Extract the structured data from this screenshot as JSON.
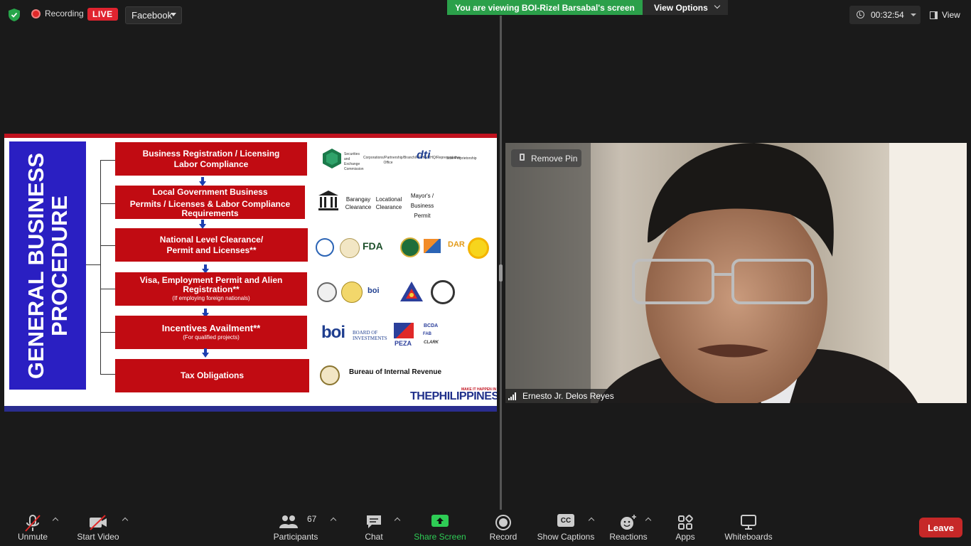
{
  "topbar": {
    "recording_label": "Recording",
    "live_label": "LIVE",
    "stream_target": "Facebook",
    "viewing_banner": "You are viewing BOI-Rizel Barsabal's screen",
    "view_options_label": "View Options",
    "elapsed_time": "00:32:54",
    "view_label": "View"
  },
  "slide": {
    "title_line1": "GENERAL BUSINESS",
    "title_line2": "PROCEDURE",
    "steps": [
      {
        "line1": "Business Registration / Licensing",
        "line2": "Labor Compliance",
        "sub": ""
      },
      {
        "line1": "Local Government Business",
        "line2": "Permits / Licenses & Labor Compliance Requirements",
        "sub": ""
      },
      {
        "line1": "National Level Clearance/",
        "line2": "Permit and Licenses**",
        "sub": ""
      },
      {
        "line1": "Visa, Employment Permit and Alien Registration**",
        "line2": "",
        "sub": "(If employing foreign nationals)"
      },
      {
        "line1": "Incentives Availment**",
        "line2": "",
        "sub": "(For qualified projects)"
      },
      {
        "line1": "Tax Obligations",
        "line2": "",
        "sub": ""
      }
    ],
    "row1": {
      "sec_name": "Securities and Exchange Commission",
      "sec_desc": "Corporations/Partnership/Branch/ROHQ/RHQ/Representative Office",
      "dti": "dti",
      "dti_desc": "Sole Proprietorship"
    },
    "row2": {
      "barangay": "Barangay Clearance",
      "locational": "Locational Clearance",
      "mayors": "Mayor's / Business Permit"
    },
    "row3": {
      "fda": "FDA",
      "dar": "DAR"
    },
    "row4": {
      "boi": "boi"
    },
    "row5": {
      "boi": "boi",
      "boi_name": "BOARD OF INVESTMENTS",
      "peza": "PEZA",
      "bcda": "BCDA",
      "fab": "FAB",
      "clark": "CLARK"
    },
    "row6": {
      "bir": "Bureau of Internal Revenue"
    },
    "brand": "THEPHILIPPINES",
    "brand_tag": "MAKE IT HAPPEN IN"
  },
  "video": {
    "pin_label": "Remove Pin",
    "participant_name": "Ernesto Jr. Delos Reyes"
  },
  "toolbar": {
    "unmute": "Unmute",
    "start_video": "Start Video",
    "participants": "Participants",
    "participants_count": "67",
    "chat": "Chat",
    "share_screen": "Share Screen",
    "record": "Record",
    "show_captions": "Show Captions",
    "captions_icon": "CC",
    "reactions": "Reactions",
    "apps": "Apps",
    "whiteboards": "Whiteboards",
    "leave": "Leave"
  },
  "colors": {
    "banner_green": "#2ba04a",
    "live_red": "#e0242f",
    "slide_red": "#c10b12",
    "slide_blue": "#2a1fc2",
    "leave_red": "#c62828"
  }
}
